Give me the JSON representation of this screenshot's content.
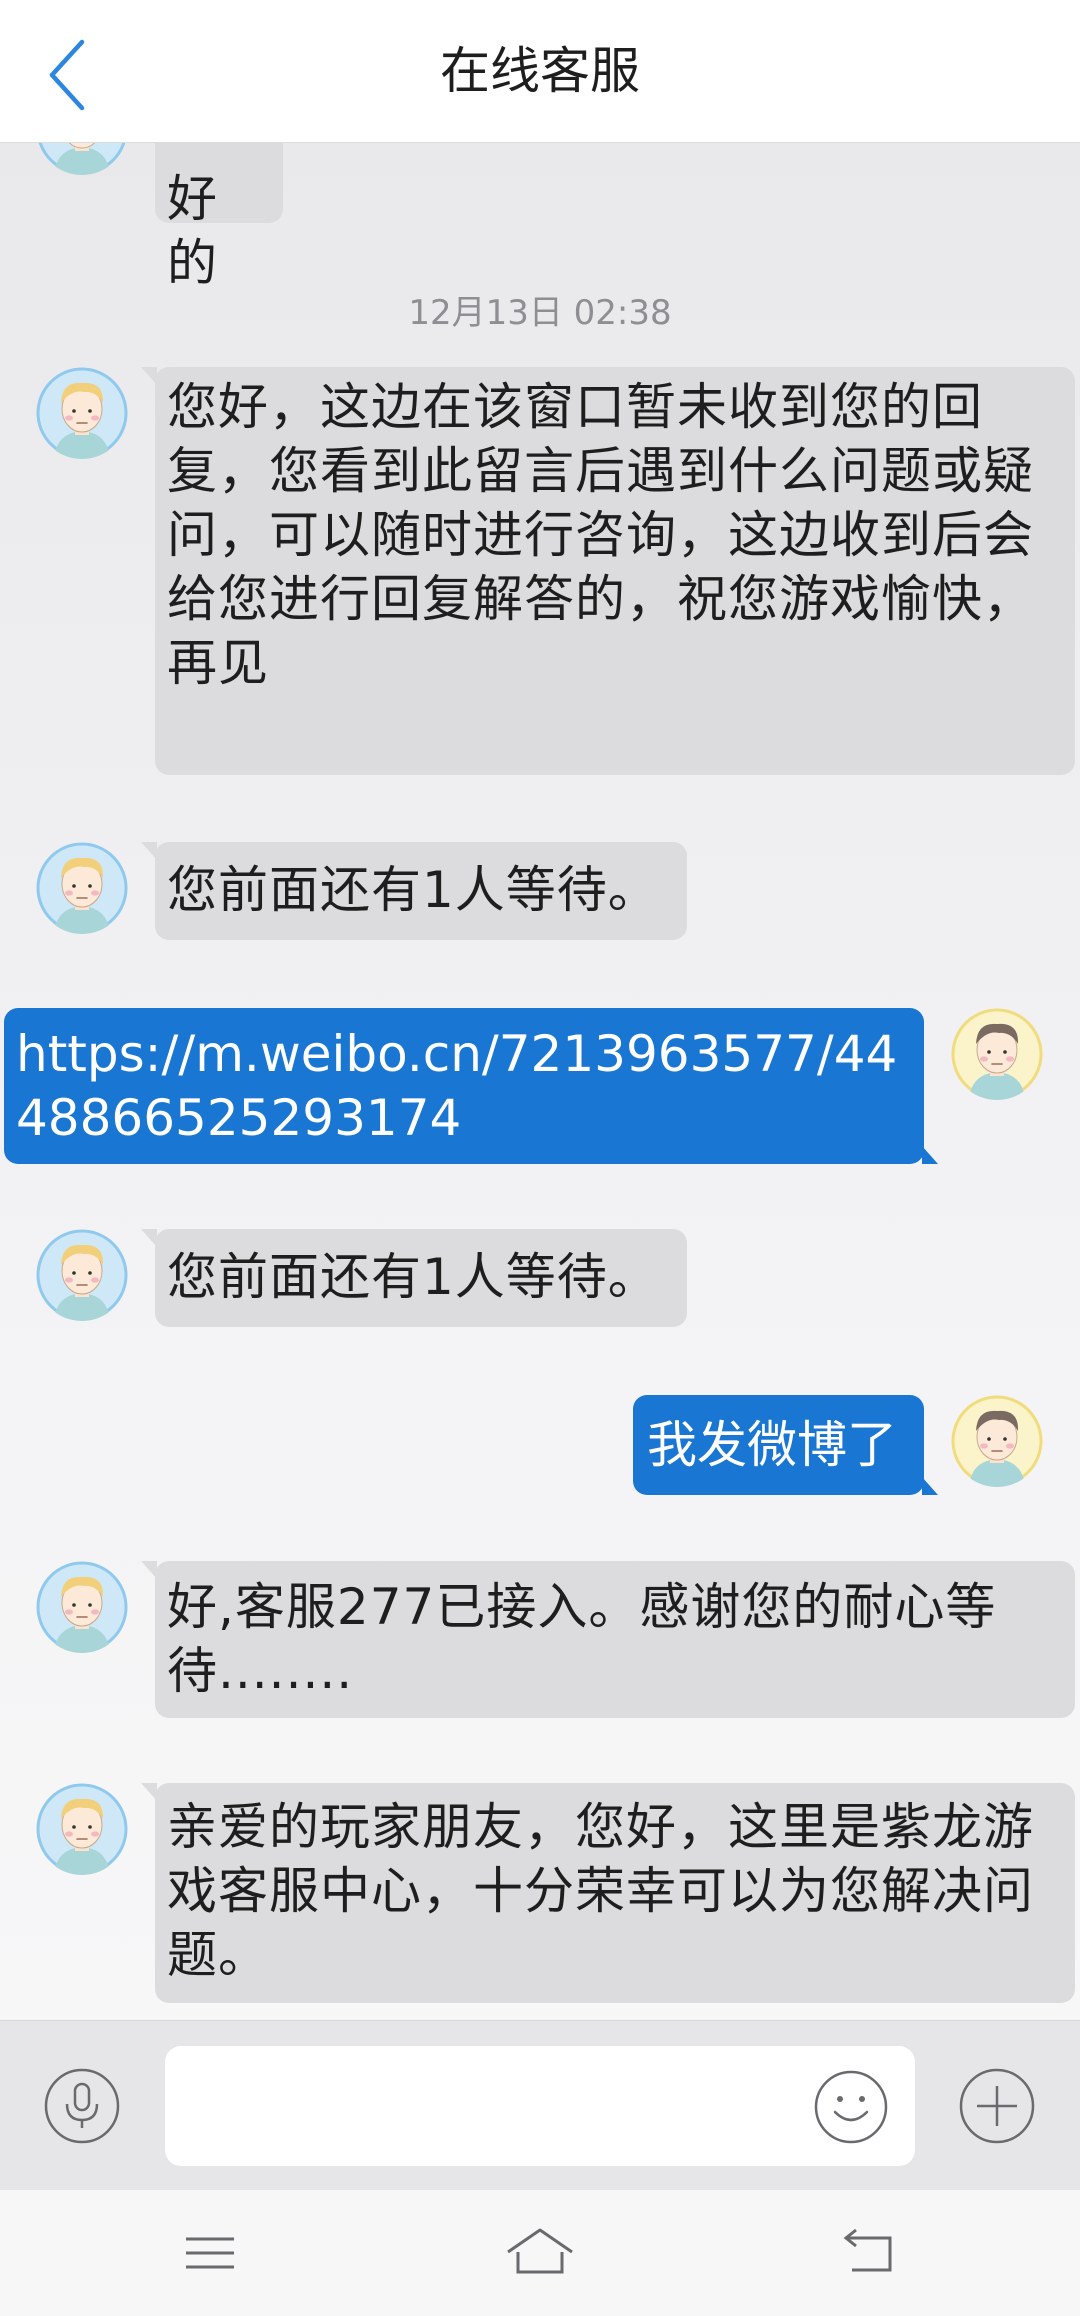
{
  "header": {
    "title": "在线客服",
    "back_icon": "chevron-left-icon"
  },
  "colors": {
    "accent": "#1976d2",
    "incoming_bubble": "#dcdcde",
    "outgoing_bubble": "#1976d2",
    "timestamp": "#8e8e93"
  },
  "messages": [
    {
      "side": "in",
      "text": "好的"
    },
    {
      "type": "timestamp",
      "text": "12月13日 02:38"
    },
    {
      "side": "in",
      "text": "您好，这边在该窗口暂未收到您的回复，您看到此留言后遇到什么问题或疑问，可以随时进行咨询，这边收到后会给您进行回复解答的，祝您游戏愉快，再见"
    },
    {
      "side": "in",
      "text": "您前面还有1人等待。"
    },
    {
      "side": "out",
      "text": "https://m.weibo.cn/7213963577/4448866525293174"
    },
    {
      "side": "in",
      "text": "您前面还有1人等待。"
    },
    {
      "side": "out",
      "text": "我发微博了"
    },
    {
      "side": "in",
      "text": "好,客服277已接入。感谢您的耐心等待........"
    },
    {
      "side": "in",
      "text": "亲爱的玩家朋友，您好，这里是紫龙游戏客服中心，十分荣幸可以为您解决问题。"
    }
  ],
  "input_bar": {
    "placeholder": "",
    "voice_icon": "microphone-icon",
    "emoji_icon": "smiley-icon",
    "more_icon": "plus-icon"
  },
  "system_nav": {
    "menu_icon": "menu-icon",
    "home_icon": "home-icon",
    "back_icon": "back-arrow-icon"
  }
}
